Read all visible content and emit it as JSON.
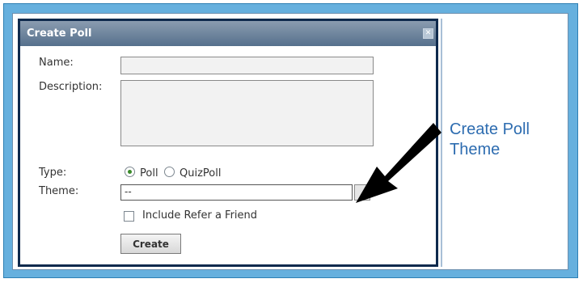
{
  "dialog": {
    "title": "Create Poll",
    "close_glyph": "✕",
    "name_label": "Name:",
    "description_label": "Description:",
    "type_label": "Type:",
    "type_options": [
      {
        "label": "Poll",
        "selected": true
      },
      {
        "label": "QuizPoll",
        "selected": false
      }
    ],
    "theme_label": "Theme:",
    "theme_value": "--",
    "refer_friend_label": "Include Refer a Friend",
    "refer_friend_checked": false,
    "create_label": "Create"
  },
  "annotation": {
    "line1": "Create Poll",
    "line2": "Theme"
  },
  "colors": {
    "outer_frame": "#66b0de",
    "titlebar": "#56708c",
    "annotation_text": "#2d6cb0",
    "radio_dot": "#3a8a2a"
  },
  "icons": {
    "close": "close-icon",
    "arrow": "pointer-arrow-icon"
  }
}
